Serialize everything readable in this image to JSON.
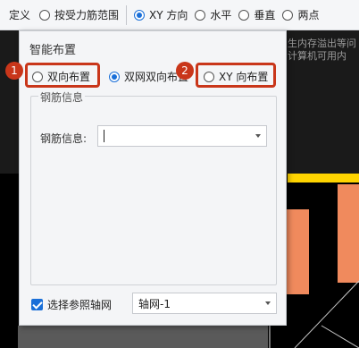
{
  "toolbar": {
    "partial_label": "定义",
    "options": [
      {
        "label": "按受力筋范围",
        "selected": false
      },
      {
        "label": "XY 方向",
        "selected": true
      },
      {
        "label": "水平",
        "selected": false
      },
      {
        "label": "垂直",
        "selected": false
      },
      {
        "label": "两点",
        "selected": false
      }
    ]
  },
  "canvas": {
    "note_lines": [
      "生内存溢出等问",
      "计算机可用内"
    ]
  },
  "dialog": {
    "title": "智能布置",
    "layout_options": [
      {
        "label": "双向布置",
        "selected": false,
        "badge": "1"
      },
      {
        "label": "双网双向布置",
        "selected": true
      },
      {
        "label": "XY 向布置",
        "selected": false,
        "badge": "2"
      }
    ],
    "rebar_group": {
      "legend": "钢筋信息",
      "field_label": "钢筋信息:",
      "field_value": ""
    },
    "axis_checkbox": {
      "label": "选择参照轴网",
      "checked": true
    },
    "axis_select": {
      "value": "轴网-1"
    }
  },
  "colors": {
    "highlight": "#c9361a",
    "accent": "#1a6fd8",
    "orange": "#f08a5d",
    "yellow": "#ffd400",
    "magenta": "#e040e0"
  }
}
